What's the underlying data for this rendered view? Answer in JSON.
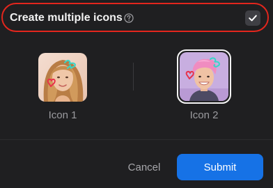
{
  "settings": {
    "toggle_label": "Create multiple icons",
    "help_icon": "question-circle-icon",
    "checkbox_checked": true,
    "checkbox_icon": "checkmark-icon"
  },
  "icons": [
    {
      "caption": "Icon 1",
      "image": "girl-portrait-with-doodles",
      "selected": false
    },
    {
      "caption": "Icon 2",
      "image": "boy-pink-hair-portrait-with-doodles",
      "selected": true
    }
  ],
  "actions": {
    "cancel_label": "Cancel",
    "submit_label": "Submit"
  },
  "colors": {
    "background": "#1f1f21",
    "highlight_border": "#e3261d",
    "primary_button": "#1672e6",
    "doodle_cyan": "#39d6c8",
    "doodle_red": "#e8324a"
  }
}
